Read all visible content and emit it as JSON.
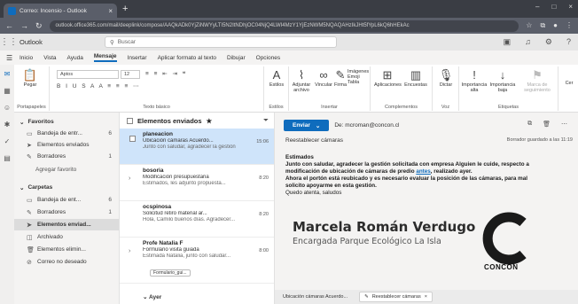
{
  "browser": {
    "tab_title": "Correo: Incensio - Outlook",
    "tab_close": "×",
    "new_tab": "+",
    "url": "outlook.office365.com/mail/deeplink/compose/AAQkADk0YjZiNWYyLTI5N2ItNDhjOC04NjQ4LWI4MzY1YjEzNWM5NQAQAHzIkJHt5fYpL6kQ6hHEkAc",
    "window_controls": [
      "–",
      "□",
      "×"
    ]
  },
  "outlook": {
    "app_label": "Outlook",
    "search_placeholder": "Buscar",
    "menus": [
      "Inicio",
      "Vista",
      "Ayuda",
      "Mensaje",
      "Insertar",
      "Aplicar formato al texto",
      "Dibujar",
      "Opciones"
    ],
    "active_menu": "Mensaje"
  },
  "ribbon": {
    "paste": "Pegar",
    "clipboard_label": "Portapapeles",
    "font_name": "Aptos",
    "font_size": "12",
    "font_label": "Texto básico",
    "styles": "Estilos",
    "styles_label": "Estilos",
    "attach": "Adjuntar archivo",
    "link": "Vincular",
    "signature": "Firma",
    "images": "Imágenes",
    "emoji": "Emoji",
    "table": "Tabla",
    "insert_label": "Insertar",
    "apps": "Aplicaciones",
    "polls": "Encuestas",
    "addins_label": "Complementos",
    "dictate": "Dictar",
    "voice_label": "Voz",
    "high_importance": "Importancia alta",
    "low_importance": "Importancia baja",
    "follow_up": "Marca de seguimiento",
    "tags_label": "Etiquetas",
    "more": "Cer"
  },
  "folders": [
    {
      "label": "Favoritos",
      "type": "head"
    },
    {
      "label": "Bandeja de entr...",
      "count": "6",
      "icon": "inbox-icon"
    },
    {
      "label": "Elementos enviados",
      "icon": "sent-icon"
    },
    {
      "label": "Borradores",
      "count": "1",
      "icon": "draft-icon"
    },
    {
      "label": "Agregar favorito",
      "icon": ""
    },
    {
      "label": "Carpetas",
      "type": "head"
    },
    {
      "label": "Bandeja de ent...",
      "count": "6",
      "icon": "inbox-icon"
    },
    {
      "label": "Borradores",
      "count": "1",
      "icon": "draft-icon"
    },
    {
      "label": "Elementos enviad...",
      "icon": "sent-icon",
      "selected": true
    },
    {
      "label": "Archivado",
      "icon": "archive-icon"
    },
    {
      "label": "Elementos elimin...",
      "icon": "trash-icon"
    },
    {
      "label": "Correo no deseado",
      "icon": "junk-icon"
    }
  ],
  "message_list": {
    "title": "Elementos enviados",
    "messages": [
      {
        "from": "planeacion",
        "subject": "Ubicación cámaras Acuerdo...",
        "preview": "Junto con saludar, agradecer la gestión",
        "time": "15:06"
      },
      {
        "from": "bosoria",
        "subject": "Modificación presupuestaria",
        "preview": "Estimados, les adjunto propuesta...",
        "time": "8:20"
      },
      {
        "from": "ocspinosa",
        "subject": "Solicitud retiro material ar...",
        "preview": "Hola, Camilo buenos días. Agradecer...",
        "time": "8:20"
      },
      {
        "from": "Profe Natalia F",
        "subject": "Formulario visita guiada",
        "preview": "Estimada Natalia, junto con saludar...",
        "time": "8:00",
        "attachment": "Formulario_gui..."
      }
    ],
    "group_header": "Ayer"
  },
  "reading": {
    "send_label": "Enviar",
    "to_label": "De: mcroman@concon.cl",
    "subject": "Reestablecer cámaras",
    "draft_saved": "Borrador guardado a las 11:19",
    "greeting": "Estimados",
    "line1": "Junto con saludar, agradecer la gestión solicitada con empresa Alguien le cuide, respecto a",
    "line2a": "modificación de ubicación de cámaras de predio ",
    "line2link": "antes",
    "line2b": ", realizado ayer.",
    "line3": "Ahora el portón está reubicado y es necesario evaluar la posición de las cámaras, para mal",
    "line4": "solicito apoyarme en esta gestión.",
    "line5": "Quedo atenta, saludos",
    "sig_name": "Marcela Román Verdugo",
    "sig_role": "Encargada Parque Ecológico La Isla",
    "logo_text": "CONCÓN",
    "bottom_tabs": [
      "Ubicación cámaras Acuerdo...",
      "Reestablecer cámaras"
    ]
  },
  "colors": {
    "accent": "#0f6cbd",
    "selected_item": "#cfe4fa"
  }
}
